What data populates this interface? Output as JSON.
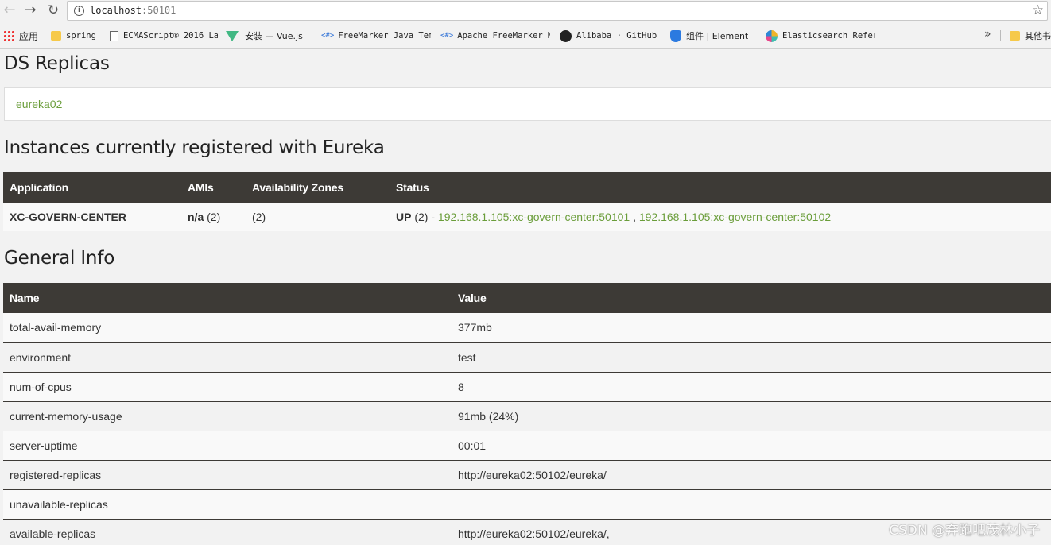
{
  "browser": {
    "url_host": "localhost",
    "url_port": ":50101",
    "bookmarks": [
      {
        "label": "应用",
        "icon": "apps-icon"
      },
      {
        "label": "spring",
        "icon": "folder-icon"
      },
      {
        "label": "ECMAScript® 2016 La",
        "icon": "document-icon"
      },
      {
        "label": "安装 — Vue.js",
        "icon": "vue-icon"
      },
      {
        "label": "FreeMarker Java Tem",
        "icon": "code-icon"
      },
      {
        "label": "Apache FreeMarker M",
        "icon": "code-icon"
      },
      {
        "label": "Alibaba · GitHub",
        "icon": "github-icon"
      },
      {
        "label": "组件 | Element",
        "icon": "shield-icon"
      },
      {
        "label": "Elasticsearch Refer",
        "icon": "elastic-icon"
      },
      {
        "label": "其他书",
        "icon": "folder-icon"
      }
    ],
    "more_label": "»"
  },
  "replicas": {
    "title": "DS Replicas",
    "items": [
      "eureka02"
    ]
  },
  "instances": {
    "title": "Instances currently registered with Eureka",
    "headers": [
      "Application",
      "AMIs",
      "Availability Zones",
      "Status"
    ],
    "rows": [
      {
        "application": "XC-GOVERN-CENTER",
        "amis_bold": "n/a",
        "amis_count": " (2)",
        "zones": "(2)",
        "status_bold": "UP",
        "status_count": " (2) - ",
        "link1": "192.168.1.105:xc-govern-center:50101",
        "link_sep": " , ",
        "link2": "192.168.1.105:xc-govern-center:50102"
      }
    ]
  },
  "general": {
    "title": "General Info",
    "headers": [
      "Name",
      "Value"
    ],
    "rows": [
      {
        "name": "total-avail-memory",
        "value": "377mb"
      },
      {
        "name": "environment",
        "value": "test"
      },
      {
        "name": "num-of-cpus",
        "value": "8"
      },
      {
        "name": "current-memory-usage",
        "value": "91mb (24%)"
      },
      {
        "name": "server-uptime",
        "value": "00:01"
      },
      {
        "name": "registered-replicas",
        "value": "http://eureka02:50102/eureka/"
      },
      {
        "name": "unavailable-replicas",
        "value": ""
      },
      {
        "name": "available-replicas",
        "value": "http://eureka02:50102/eureka/,"
      }
    ]
  },
  "watermark": "CSDN @奔跑吧茂林小子",
  "colors": {
    "header_bg": "#3d3a36",
    "link": "#6a9d3a"
  }
}
